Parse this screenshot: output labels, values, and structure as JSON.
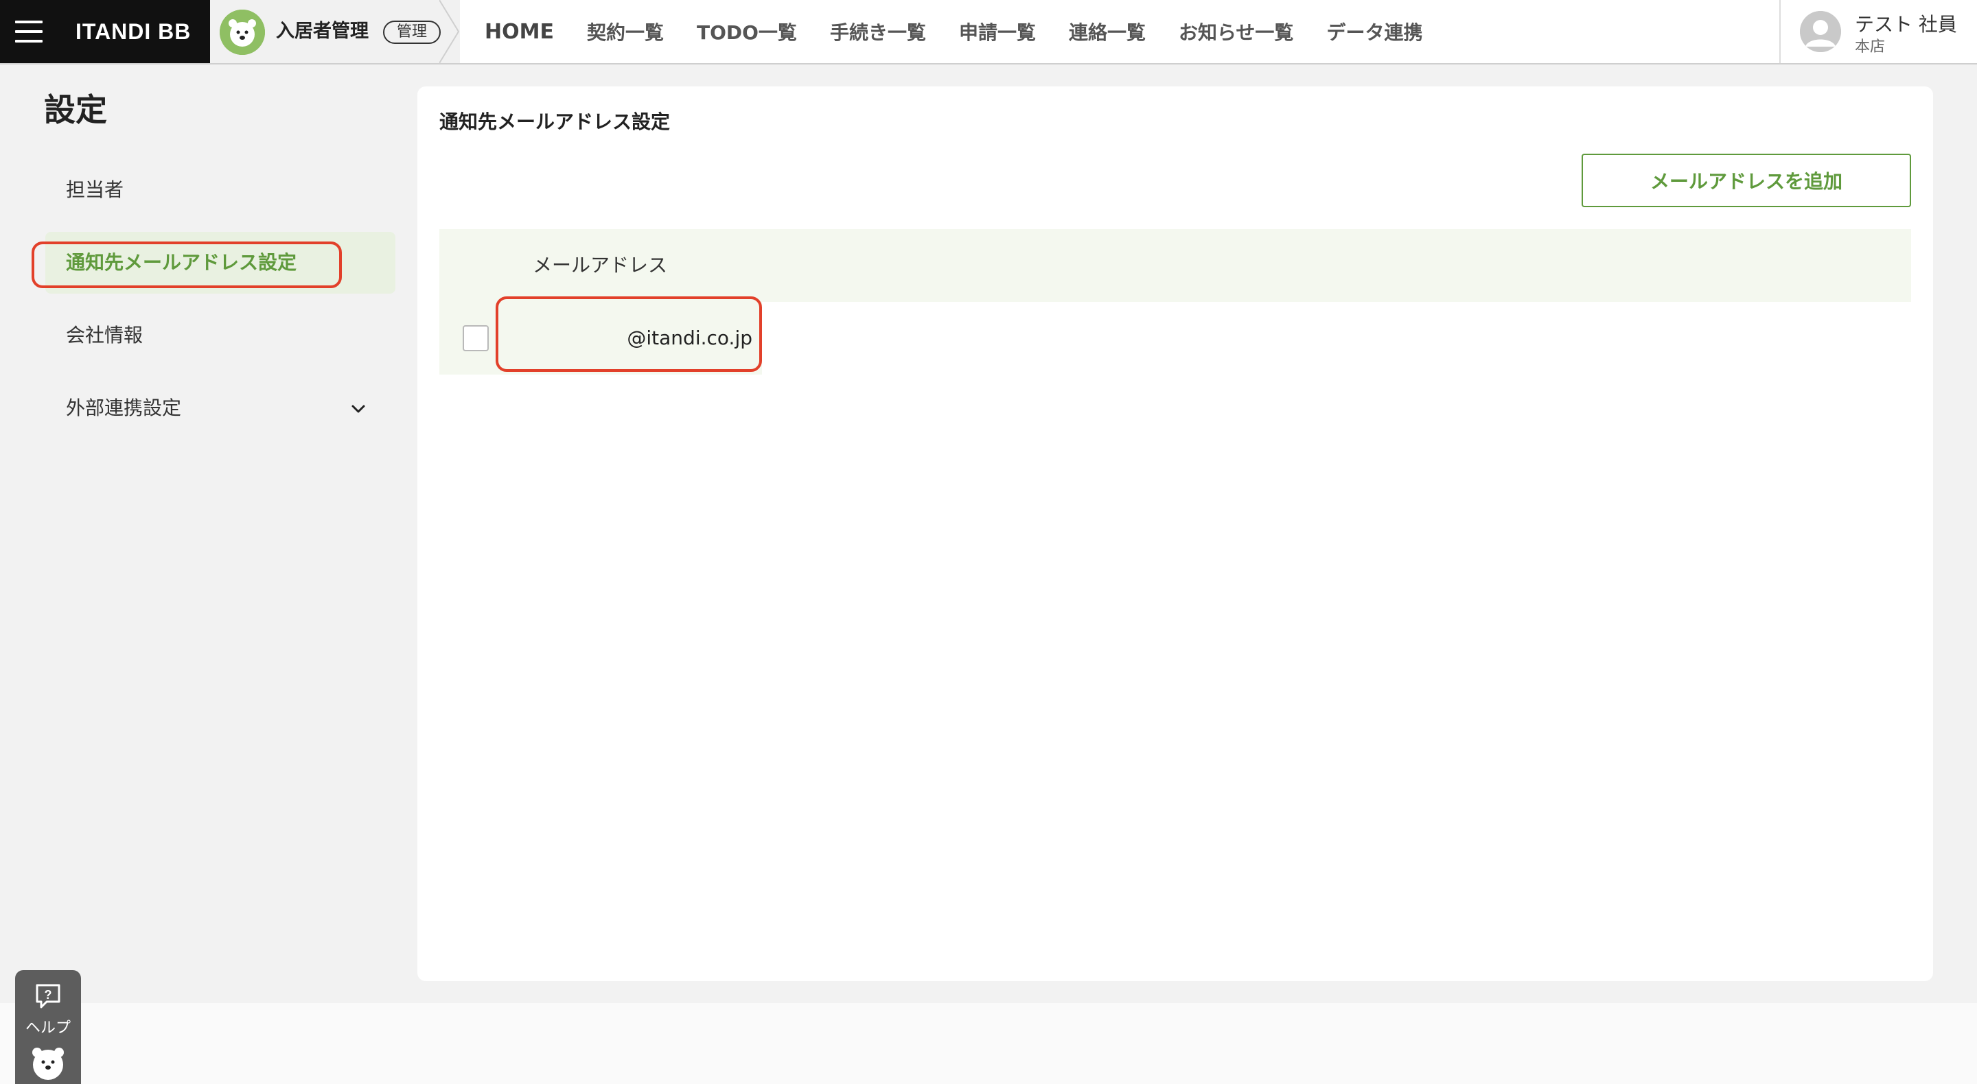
{
  "header": {
    "menu_icon": "hamburger-menu-icon",
    "brand": "ITANDI BB",
    "app_name": "入居者管理",
    "app_badge": "管理",
    "nav": [
      "HOME",
      "契約一覧",
      "TODO一覧",
      "手続き一覧",
      "申請一覧",
      "連絡一覧",
      "お知らせ一覧",
      "データ連携"
    ],
    "user": {
      "name": "テスト 社員",
      "branch": "本店"
    }
  },
  "sidebar": {
    "title": "設定",
    "items": [
      {
        "label": "担当者"
      },
      {
        "label": "通知先メールアドレス設定",
        "active": true
      },
      {
        "label": "会社情報"
      },
      {
        "label": "外部連携設定",
        "expandable": true
      }
    ]
  },
  "main": {
    "title": "通知先メールアドレス設定",
    "add_button": "メールアドレスを追加",
    "table": {
      "header": "メールアドレス",
      "rows": [
        {
          "email": "@itandi.co.jp",
          "checked": false
        }
      ]
    }
  },
  "help": {
    "label": "ヘルプ"
  },
  "colors": {
    "accent": "#5f9a3c",
    "highlight": "#e2402a",
    "header_dark": "#111111"
  }
}
